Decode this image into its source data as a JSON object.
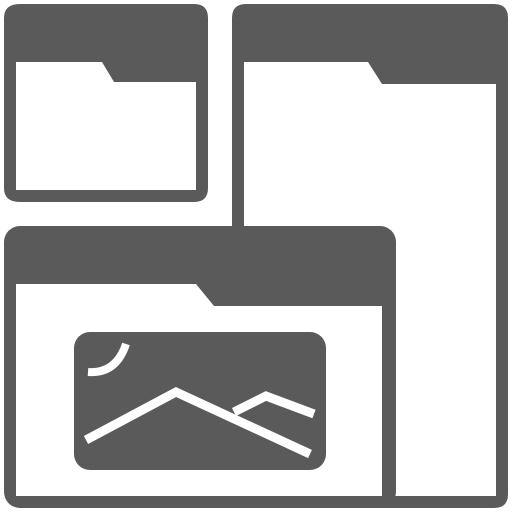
{
  "icon": {
    "name": "folder-windows-image-icon",
    "color": "#5a5a5a",
    "background": "#ffffff"
  }
}
